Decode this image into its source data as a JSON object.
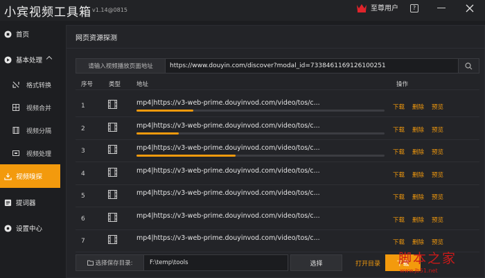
{
  "app": {
    "title": "小宾视频工具箱",
    "version": "v1.14@0815",
    "vip_label": "至尊用户",
    "help": "?"
  },
  "sidebar": {
    "home": "首页",
    "basic": "基本处理",
    "format": "格式转换",
    "merge": "视频合并",
    "split": "视频分隔",
    "process": "视频处理",
    "sniff": "视频嗅探",
    "prompter": "提词器",
    "settings": "设置中心"
  },
  "main": {
    "title": "网页资源探测",
    "url_label": "请输入视频播放页面地址",
    "url_value": "https://www.douyin.com/discover?modal_id=7338461169126100251",
    "headers": {
      "idx": "序号",
      "type": "类型",
      "url": "地址",
      "actions": "操作"
    },
    "rows": [
      {
        "idx": "1",
        "url": "mp4|https://v3-web-prime.douyinvod.com/video/tos/c...",
        "progress": 0.23
      },
      {
        "idx": "2",
        "url": "mp4|https://v3-web-prime.douyinvod.com/video/tos/c...",
        "progress": 0.17
      },
      {
        "idx": "3",
        "url": "mp4|https://v3-web-prime.douyinvod.com/video/tos/c...",
        "progress": 0.4
      },
      {
        "idx": "4",
        "url": "mp4|https://v3-web-prime.douyinvod.com/video/tos/c..."
      },
      {
        "idx": "5",
        "url": "mp4|https://v3-web-prime.douyinvod.com/video/tos/c..."
      },
      {
        "idx": "6",
        "url": "mp4|https://v3-web-prime.douyinvod.com/video/tos/c..."
      },
      {
        "idx": "7",
        "url": "mp4|https://v3-web-prime.douyinvod.com/video/tos/c..."
      }
    ],
    "actions": {
      "download": "下载",
      "delete": "删除",
      "preview": "预览"
    },
    "save_label": "选择保存目录:",
    "save_path": "F:\\temp\\tools",
    "choose": "选择",
    "open_dir": "打开目录",
    "download_btn": "下载"
  },
  "watermark": {
    "top": "脚本之家",
    "bottom": "www.jb51.net"
  },
  "colors": {
    "accent": "#f39a0d",
    "bg": "#1c1d20",
    "panel": "#232428"
  }
}
